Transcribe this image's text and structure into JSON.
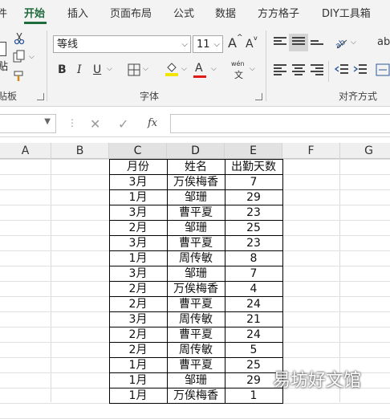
{
  "ribbon": {
    "tabs": [
      {
        "label": "件"
      },
      {
        "label": "开始"
      },
      {
        "label": "插入"
      },
      {
        "label": "页面布局"
      },
      {
        "label": "公式"
      },
      {
        "label": "数据"
      },
      {
        "label": "方方格子"
      },
      {
        "label": "DIY工具箱"
      }
    ],
    "active_tab": "开始",
    "accent_color": "#1e6b3c",
    "clipboard": {
      "label": "贴板",
      "paste_label": "贴"
    },
    "font": {
      "label": "字体",
      "font_name": "等线",
      "font_size": "11",
      "grow_label": "A",
      "shrink_label": "A",
      "bold_label": "B",
      "italic_label": "I",
      "underline_label": "U",
      "font_color_label": "A",
      "phonetic_top": "wén",
      "phonetic_bottom": "文"
    },
    "alignment": {
      "label": "对齐方式",
      "wrap_label": "ab"
    }
  },
  "formula_bar": {
    "cancel_symbol": "✕",
    "confirm_symbol": "✓",
    "fx_label": "fx",
    "value": ""
  },
  "grid": {
    "columns": [
      "A",
      "B",
      "C",
      "D",
      "E",
      "F",
      "G"
    ],
    "headers": [
      "月份",
      "姓名",
      "出勤天数"
    ],
    "rows": [
      [
        "3月",
        "万俟梅香",
        "7"
      ],
      [
        "1月",
        "邹珊",
        "29"
      ],
      [
        "3月",
        "曹平夏",
        "23"
      ],
      [
        "2月",
        "邹珊",
        "25"
      ],
      [
        "3月",
        "曹平夏",
        "23"
      ],
      [
        "1月",
        "周传敏",
        "8"
      ],
      [
        "3月",
        "邹珊",
        "7"
      ],
      [
        "2月",
        "万俟梅香",
        "4"
      ],
      [
        "2月",
        "曹平夏",
        "24"
      ],
      [
        "3月",
        "周传敏",
        "21"
      ],
      [
        "2月",
        "曹平夏",
        "24"
      ],
      [
        "2月",
        "周传敏",
        "5"
      ],
      [
        "1月",
        "曹平夏",
        "25"
      ],
      [
        "1月",
        "邹珊",
        "29"
      ],
      [
        "1月",
        "万俟梅香",
        "1"
      ]
    ]
  },
  "watermark": "易坊好文馆"
}
